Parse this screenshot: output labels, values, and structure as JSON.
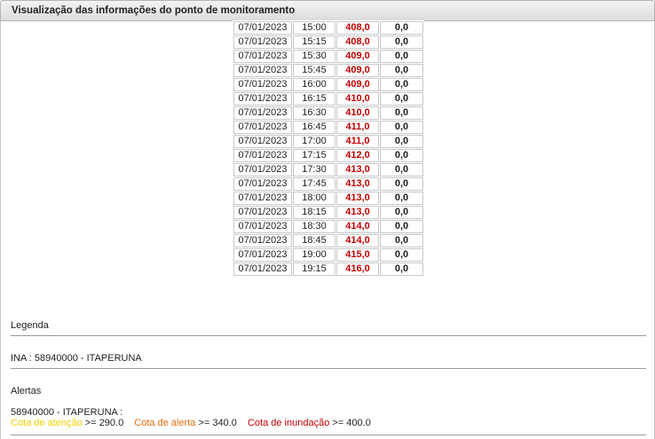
{
  "header": {
    "title": "Visualização das informações do ponto de monitoramento"
  },
  "readings": [
    {
      "date": "07/01/2023",
      "time": "15:00",
      "level": "408,0",
      "rain": "0,0"
    },
    {
      "date": "07/01/2023",
      "time": "15:15",
      "level": "408,0",
      "rain": "0,0"
    },
    {
      "date": "07/01/2023",
      "time": "15:30",
      "level": "409,0",
      "rain": "0,0"
    },
    {
      "date": "07/01/2023",
      "time": "15:45",
      "level": "409,0",
      "rain": "0,0"
    },
    {
      "date": "07/01/2023",
      "time": "16:00",
      "level": "409,0",
      "rain": "0,0"
    },
    {
      "date": "07/01/2023",
      "time": "16:15",
      "level": "410,0",
      "rain": "0,0"
    },
    {
      "date": "07/01/2023",
      "time": "16:30",
      "level": "410,0",
      "rain": "0,0"
    },
    {
      "date": "07/01/2023",
      "time": "16:45",
      "level": "411,0",
      "rain": "0,0"
    },
    {
      "date": "07/01/2023",
      "time": "17:00",
      "level": "411,0",
      "rain": "0,0"
    },
    {
      "date": "07/01/2023",
      "time": "17:15",
      "level": "412,0",
      "rain": "0,0"
    },
    {
      "date": "07/01/2023",
      "time": "17:30",
      "level": "413,0",
      "rain": "0,0"
    },
    {
      "date": "07/01/2023",
      "time": "17:45",
      "level": "413,0",
      "rain": "0,0"
    },
    {
      "date": "07/01/2023",
      "time": "18:00",
      "level": "413,0",
      "rain": "0,0"
    },
    {
      "date": "07/01/2023",
      "time": "18:15",
      "level": "413,0",
      "rain": "0,0"
    },
    {
      "date": "07/01/2023",
      "time": "18:30",
      "level": "414,0",
      "rain": "0,0"
    },
    {
      "date": "07/01/2023",
      "time": "18:45",
      "level": "414,0",
      "rain": "0,0"
    },
    {
      "date": "07/01/2023",
      "time": "19:00",
      "level": "415,0",
      "rain": "0,0"
    },
    {
      "date": "07/01/2023",
      "time": "19:15",
      "level": "416,0",
      "rain": "0,0"
    }
  ],
  "legend": {
    "title": "Legenda",
    "station": "INA : 58940000 - ITAPERUNA"
  },
  "alerts": {
    "title": "Alertas",
    "station": "58940000 - ITAPERUNA :",
    "attention_label": "Cota de atenção",
    "attention_value": " >= 290.0",
    "alert_label": "Cota de alerta",
    "alert_value": " >= 340.0",
    "flood_label": "Cota de inundação",
    "flood_value": " >= 400.0"
  },
  "colors": {
    "level_text": "#c00000",
    "attention": "#f0d000",
    "alert": "#e46c0a",
    "flood": "#c00000"
  }
}
